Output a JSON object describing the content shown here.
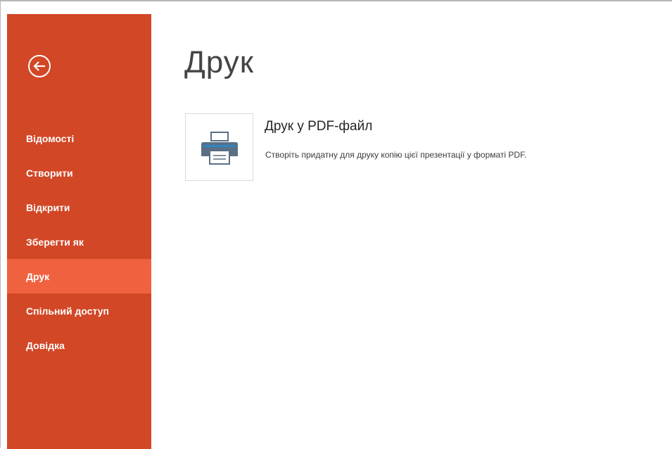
{
  "colors": {
    "sidebar_bg": "#d24726",
    "sidebar_active": "#f0623f",
    "printer_body": "#5a6f86",
    "printer_accent": "#2e86c1"
  },
  "back": {
    "icon": "back-arrow-circle-icon"
  },
  "nav": {
    "items": [
      {
        "label": "Відомості",
        "active": false
      },
      {
        "label": "Створити",
        "active": false
      },
      {
        "label": "Відкрити",
        "active": false
      },
      {
        "label": "Зберегти як",
        "active": false
      },
      {
        "label": "Друк",
        "active": true
      },
      {
        "label": "Спільний доступ",
        "active": false
      },
      {
        "label": "Довідка",
        "active": false
      }
    ]
  },
  "main": {
    "title": "Друк",
    "option": {
      "icon": "printer-icon",
      "title": "Друк у PDF-файл",
      "description": "Створіть придатну для друку копію цієї презентації у форматі PDF."
    }
  }
}
